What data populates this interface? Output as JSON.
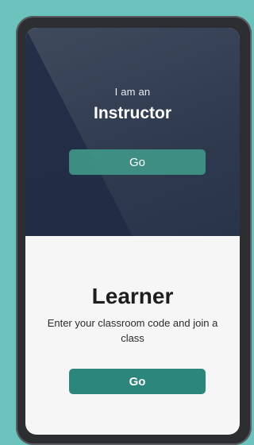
{
  "instructor": {
    "kicker": "I am an",
    "title": "Instructor",
    "button_label": "Go"
  },
  "learner": {
    "title": "Learner",
    "description": "Enter your classroom code and join a class",
    "button_label": "Go"
  },
  "colors": {
    "background": "#6cc3bd",
    "top_panel": "#2f3a4f",
    "accent": "#2d867c"
  }
}
